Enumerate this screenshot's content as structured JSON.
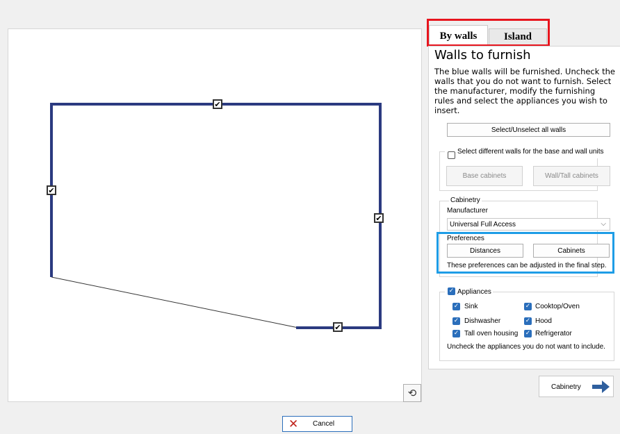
{
  "tabs": [
    {
      "label": "By walls",
      "active": true
    },
    {
      "label": "Island",
      "active": false
    }
  ],
  "panel": {
    "title": "Walls to furnish",
    "description": "The blue walls will be furnished. Uncheck the walls that you do not want to furnish. Select the manufacturer, modify the furnishing rules and select the appliances you wish to insert.",
    "select_all_label": "Select/Unselect all walls",
    "different_walls_label": "Select different walls for the base and wall units",
    "different_walls_checked": false,
    "base_cabinets_label": "Base cabinets",
    "wall_tall_cabinets_label": "Wall/Tall cabinets"
  },
  "cabinetry": {
    "legend": "Cabinetry",
    "manufacturer_label": "Manufacturer",
    "manufacturer_value": "Universal Full Access",
    "preferences_label": "Preferences",
    "distances_label": "Distances",
    "cabinets_label": "Cabinets",
    "preferences_note": "These preferences can be adjusted in the final step."
  },
  "appliances": {
    "label": "Appliances",
    "checked": true,
    "items": [
      {
        "label": "Sink",
        "checked": true
      },
      {
        "label": "Cooktop/Oven",
        "checked": true
      },
      {
        "label": "Dishwasher",
        "checked": true
      },
      {
        "label": "Hood",
        "checked": true
      },
      {
        "label": "Tall oven housing",
        "checked": true
      },
      {
        "label": "Refrigerator",
        "checked": true
      }
    ],
    "note": "Uncheck the appliances you do not want to include."
  },
  "next_button_label": "Cabinetry",
  "cancel_button_label": "Cancel",
  "colors": {
    "wall_blue": "#2b3a80",
    "tab_highlight": "#e8151e",
    "pref_highlight": "#1e9de6",
    "checkbox_blue": "#2a6ebb",
    "arrow_blue": "#2f5f9e",
    "cancel_red": "#c0241c"
  }
}
